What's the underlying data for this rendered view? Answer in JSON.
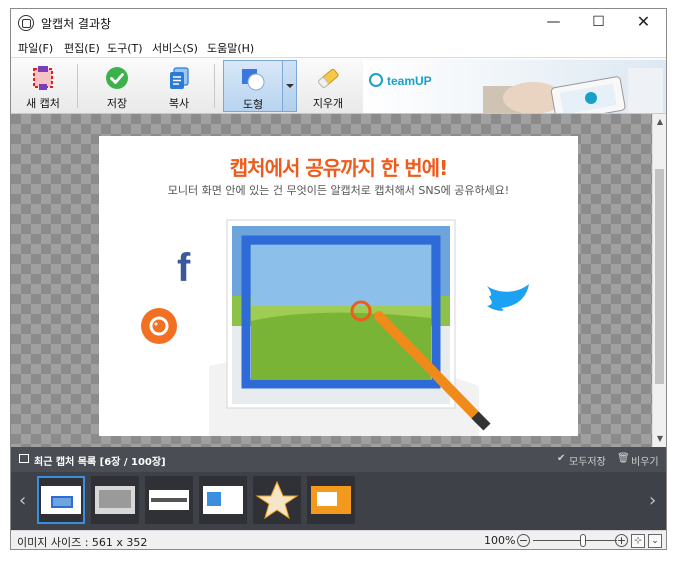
{
  "window": {
    "title": "알캡처 결과창",
    "minimize": "—",
    "maximize": "☐",
    "close": "✕"
  },
  "menu": [
    "파일(F)",
    "편집(E)",
    "도구(T)",
    "서비스(S)",
    "도움말(H)"
  ],
  "toolbar": {
    "new_capture": "새 캡처",
    "save": "저장",
    "copy": "복사",
    "shape": "도형",
    "eraser": "지우개"
  },
  "banner": {
    "logo": "teamUP"
  },
  "captured": {
    "headline": "캡처에서 공유까지 한 번에!",
    "subtitle": "모니터 화면 안에 있는 건 무엇이든 알캡처로 캡처해서 SNS에 공유하세요!"
  },
  "recent": {
    "title": "최근 캡처 목록 [6장 / 100장]",
    "save_all": "모두저장",
    "clear": "비우기",
    "prev": "‹",
    "next": "›"
  },
  "status": {
    "image_size": "이미지 사이즈 : 561 x 352",
    "zoom": "100%",
    "zoom_minus": "−",
    "zoom_plus": "+",
    "zoom_fraction": 0.6
  },
  "colors": {
    "accent": "#3c8fde",
    "headline": "#f05a1a",
    "strip_bg": "#3e4148",
    "header_bg": "#4a4d54"
  }
}
